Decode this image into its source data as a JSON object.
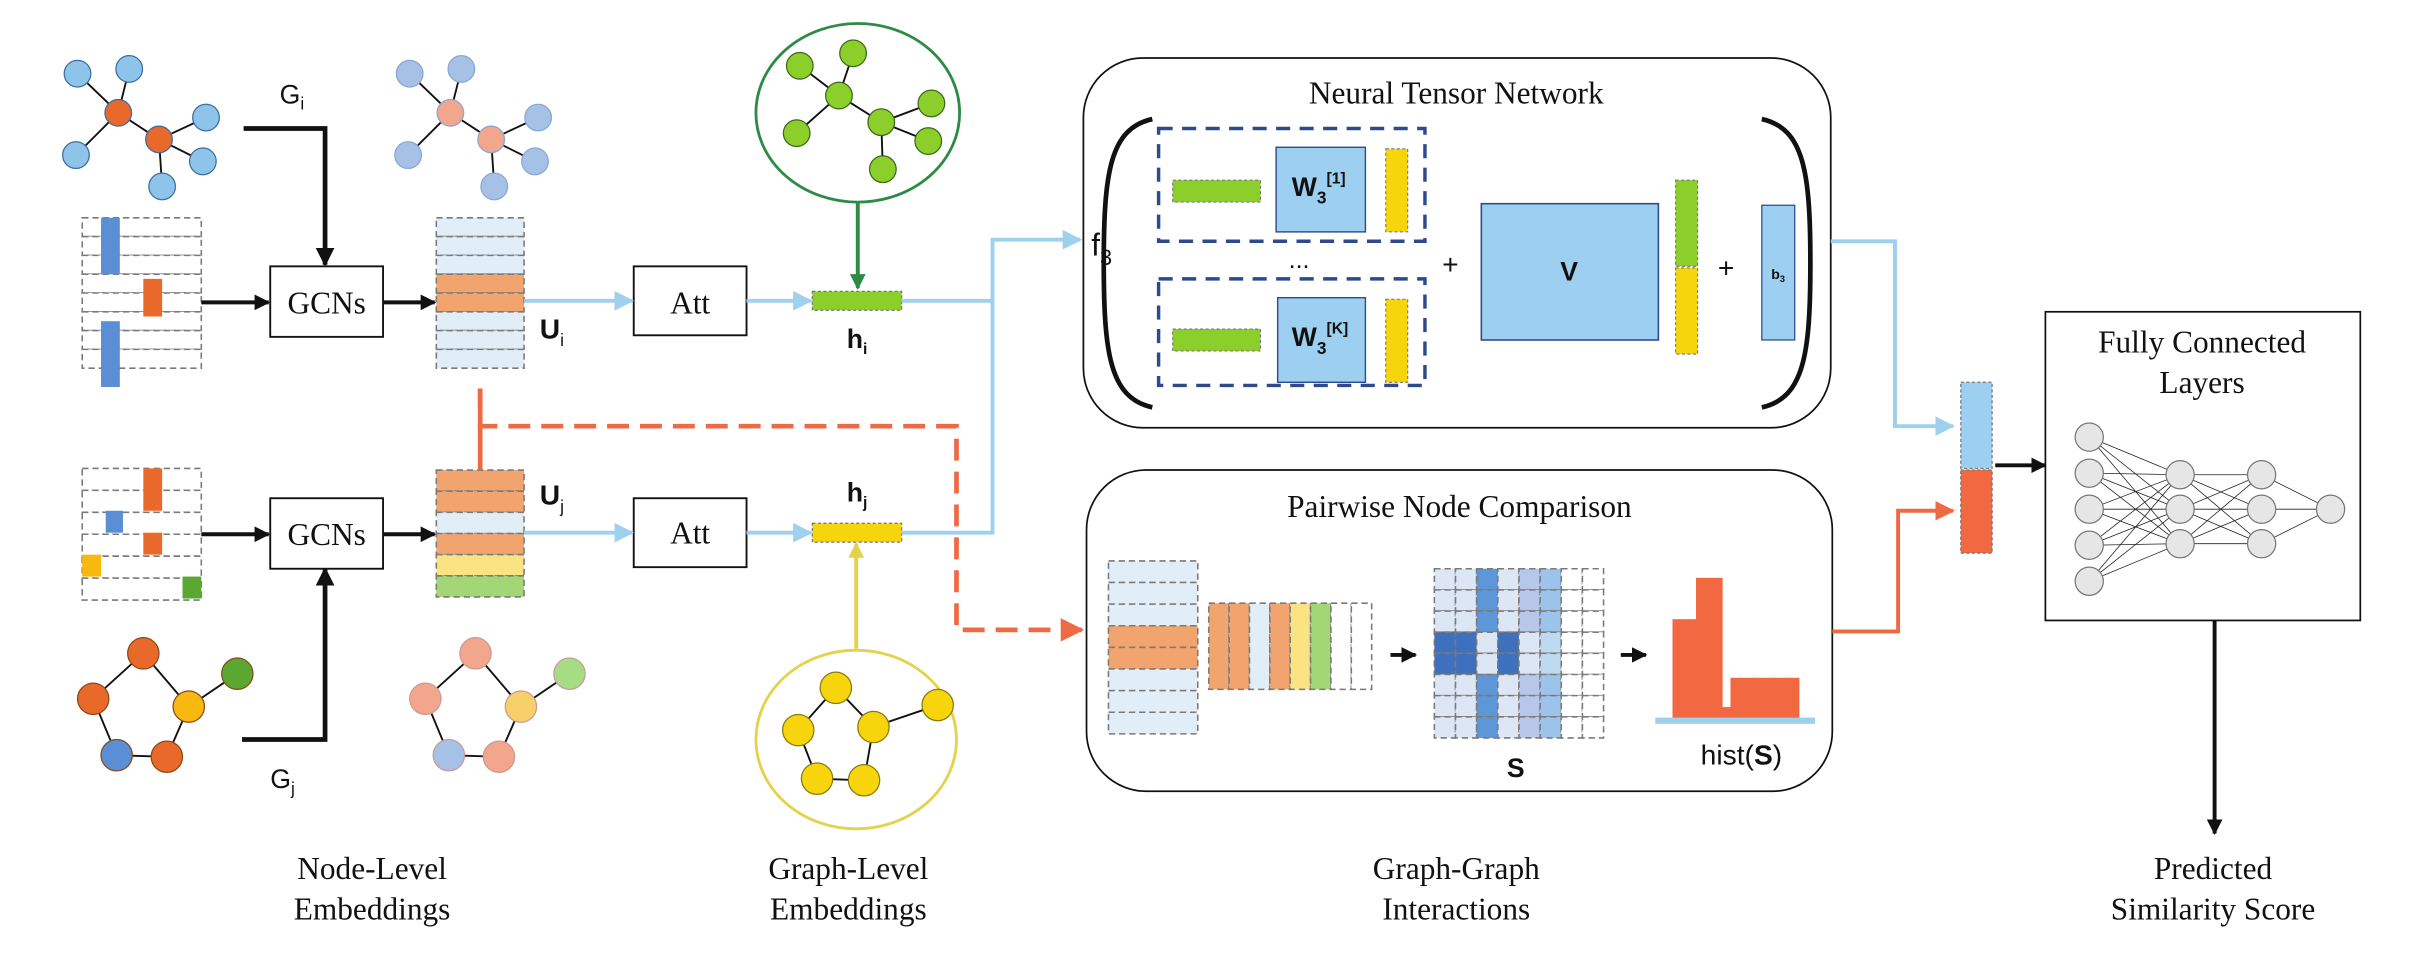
{
  "diagram": {
    "graphs": {
      "gi_label": "G",
      "gi_sub": "i",
      "gj_label": "G",
      "gj_sub": "j"
    },
    "gcn_label": "GCNs",
    "att_label": "Att",
    "embeddings": {
      "ui_label": "U",
      "ui_sub": "i",
      "uj_label": "U",
      "uj_sub": "j",
      "hi_label": "h",
      "hi_sub": "i",
      "hj_label": "h",
      "hj_sub": "j"
    },
    "ntn": {
      "title": "Neural Tensor Network",
      "f_label": "f",
      "f_sub": "3",
      "w1_label": "W",
      "w1_sub": "3",
      "w1_sup": "[1]",
      "wk_label": "W",
      "wk_sub": "3",
      "wk_sup": "[K]",
      "ellipsis": "...",
      "plus": "+",
      "v_label": "V",
      "b_label": "b",
      "b_sub": "3"
    },
    "pnc": {
      "title": "Pairwise Node Comparison",
      "s_label": "S",
      "hist_prefix": "hist(",
      "hist_s": "S",
      "hist_suffix": ")"
    },
    "fc": {
      "title_line1": "Fully Connected",
      "title_line2": "Layers",
      "layers": [
        5,
        3,
        3,
        1
      ]
    },
    "captions": {
      "node_level": [
        "Node-Level",
        "Embeddings"
      ],
      "graph_level": [
        "Graph-Level",
        "Embeddings"
      ],
      "graph_graph": [
        "Graph-Graph",
        "Interactions"
      ],
      "predicted": [
        "Predicted",
        "Similarity Score"
      ]
    },
    "colors": {
      "node_orange": "#e8692a",
      "node_blue": "#8ec3ea",
      "node_orange_light": "#f2a68c",
      "node_blue_light": "#a6c1e6",
      "green": "#8ccf2a",
      "yellow": "#f7d50c",
      "light_blue_line": "#9fd0ee",
      "orange_line": "#ee6a45",
      "dark_green": "#2e8b45",
      "yellow_line": "#e3d24a",
      "cell_light": "#e1eef8",
      "cell_orange": "#f2a46e",
      "cell_yellow": "#fbe383",
      "cell_green": "#a3d776",
      "matrix_blue": "#9ccff0",
      "ntn_dash": "#2e4a8c",
      "hist_orange": "#f26841"
    },
    "histogram": {
      "bins": [
        0.58,
        0.82,
        0.07,
        0.24,
        0.24,
        0.24,
        0.24
      ]
    },
    "similarity_matrix": [
      [
        1,
        1,
        3,
        1,
        2,
        2,
        0,
        0
      ],
      [
        1,
        1,
        3,
        1,
        2,
        2,
        0,
        0
      ],
      [
        1,
        1,
        3,
        1,
        2,
        2,
        0,
        0
      ],
      [
        4,
        4,
        1,
        4,
        1,
        5,
        0,
        0
      ],
      [
        4,
        4,
        1,
        4,
        1,
        5,
        0,
        0
      ],
      [
        1,
        1,
        3,
        1,
        2,
        2,
        0,
        0
      ],
      [
        1,
        1,
        3,
        1,
        2,
        2,
        0,
        0
      ],
      [
        1,
        1,
        3,
        1,
        2,
        2,
        0,
        0
      ]
    ]
  }
}
